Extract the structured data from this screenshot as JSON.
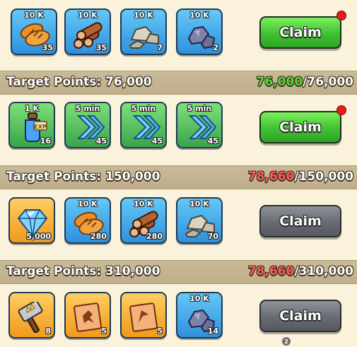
{
  "tiers": [
    {
      "items": [
        {
          "top": "10 K",
          "qty": "35",
          "icon": "bread-icon"
        },
        {
          "top": "10 K",
          "qty": "35",
          "icon": "wood-logs-icon"
        },
        {
          "top": "10 K",
          "qty": "7",
          "icon": "stone-icon"
        },
        {
          "top": "10 K",
          "qty": "2",
          "icon": "iron-ore-icon"
        }
      ],
      "button": "Claim"
    },
    {
      "title": "Target Points: 76,000",
      "progress_current": "76,000",
      "progress_sep": "/",
      "progress_goal": "76,000",
      "items": [
        {
          "top": "1 K",
          "qty": "16",
          "icon": "exp-potion-icon"
        },
        {
          "top": "5 min",
          "qty": "45",
          "icon": "build-speedup-icon"
        },
        {
          "top": "5 min",
          "qty": "45",
          "icon": "research-speedup-icon"
        },
        {
          "top": "5 min",
          "qty": "45",
          "icon": "training-speedup-icon"
        }
      ],
      "button": "Claim"
    },
    {
      "title": "Target Points: 150,000",
      "progress_current": "78,660",
      "progress_sep": "/",
      "progress_goal": "150,000",
      "items": [
        {
          "top": "",
          "qty": "5,000",
          "icon": "gem-icon"
        },
        {
          "top": "10 K",
          "qty": "280",
          "icon": "bread-icon"
        },
        {
          "top": "10 K",
          "qty": "280",
          "icon": "wood-logs-icon"
        },
        {
          "top": "10 K",
          "qty": "70",
          "icon": "stone-icon"
        }
      ],
      "button": "Claim"
    },
    {
      "title": "Target Points: 310,000",
      "progress_current": "78,660",
      "progress_sep": "/",
      "progress_goal": "310,000",
      "items": [
        {
          "top": "",
          "qty": "8",
          "icon": "golden-hammer-icon"
        },
        {
          "top": "",
          "qty": "5",
          "icon": "blueprint-scroll-icon"
        },
        {
          "top": "",
          "qty": "5",
          "icon": "map-scroll-icon"
        },
        {
          "top": "10 K",
          "qty": "14",
          "icon": "iron-ore-icon"
        }
      ],
      "button": "Claim"
    }
  ],
  "page_badge": "2",
  "colors": {
    "claim_active": "#3fc132",
    "claim_disabled": "#676b72",
    "progress_reached": "#5cd43a",
    "progress_pending": "#ff5b5b",
    "notification": "#e81b1b"
  }
}
